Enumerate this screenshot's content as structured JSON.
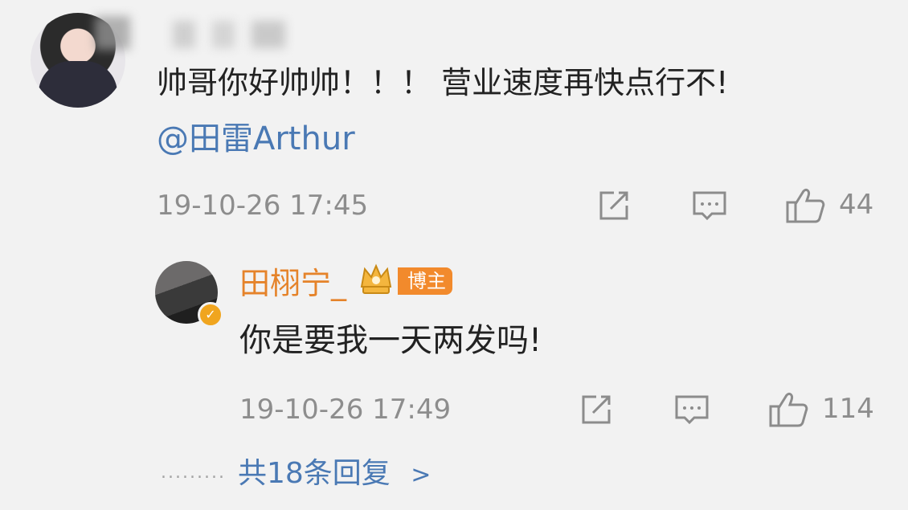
{
  "main_comment": {
    "text": "帅哥你好帅帅！！！ 营业速度再快点行不!",
    "mention": "@田雷Arthur",
    "timestamp": "19-10-26 17:45",
    "like_count": "44",
    "icons": {
      "share": "share-icon",
      "comment": "comment-icon",
      "like": "thumbs-up-icon"
    }
  },
  "reply": {
    "username": "田栩宁_",
    "badge_label": "博主",
    "badge_color": "#f28a2c",
    "text": "你是要我一天两发吗!",
    "timestamp": "19-10-26 17:49",
    "like_count": "114"
  },
  "footer": {
    "dots": ".........",
    "more_replies": "共18条回复",
    "chevron": ">"
  },
  "colors": {
    "link_blue": "#4a79b4",
    "username_orange": "#e5832a",
    "text_gray": "#8d8d8d",
    "background": "#f2f2f2"
  }
}
